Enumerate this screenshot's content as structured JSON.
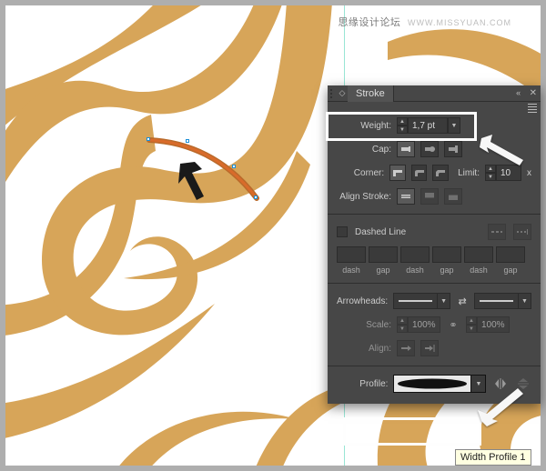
{
  "watermark": {
    "label": "思缘设计论坛",
    "url": "WWW.MISSYUAN.COM"
  },
  "panel": {
    "title": "Stroke",
    "weight": {
      "label": "Weight:",
      "value": "1,7 pt"
    },
    "cap": {
      "label": "Cap:"
    },
    "corner": {
      "label": "Corner:",
      "limit_label": "Limit:",
      "limit_value": "10",
      "limit_suffix": "x"
    },
    "align": {
      "label": "Align Stroke:"
    },
    "dashed": {
      "label": "Dashed Line",
      "cols": [
        "dash",
        "gap",
        "dash",
        "gap",
        "dash",
        "gap"
      ]
    },
    "arrowheads": {
      "label": "Arrowheads:"
    },
    "scale": {
      "label": "Scale:",
      "left": "100%",
      "right": "100%"
    },
    "alignArrow": {
      "label": "Align:"
    },
    "profile": {
      "label": "Profile:"
    }
  },
  "tooltip": "Width Profile 1"
}
